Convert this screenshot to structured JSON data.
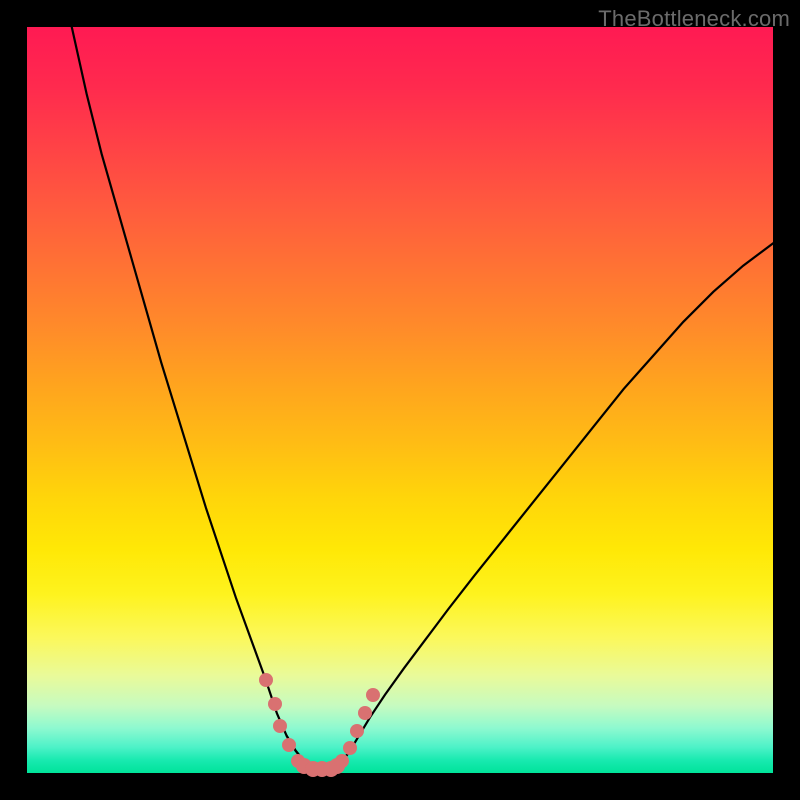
{
  "watermark": "TheBottleneck.com",
  "colors": {
    "frame_bg_top": "#ff1a53",
    "frame_bg_bottom": "#00e39a",
    "curve_stroke": "#000000",
    "marker_fill": "#d97171",
    "page_bg": "#000000",
    "watermark_text": "#6b6b6b"
  },
  "chart_data": {
    "type": "line",
    "title": "",
    "xlabel": "",
    "ylabel": "",
    "xlim": [
      0,
      100
    ],
    "ylim": [
      0,
      100
    ],
    "series": [
      {
        "name": "left-curve",
        "x": [
          6,
          8,
          10,
          12,
          14,
          16,
          18,
          20,
          22,
          24,
          26,
          28,
          30,
          32,
          33.5,
          34.8,
          36,
          37.2,
          38.4
        ],
        "y": [
          100,
          91,
          83,
          76,
          69,
          62,
          55,
          48.5,
          42,
          35.5,
          29.5,
          23.5,
          18,
          12.5,
          8,
          5,
          3,
          1.5,
          0.7
        ]
      },
      {
        "name": "right-curve",
        "x": [
          41.4,
          42.3,
          43.3,
          44.5,
          46,
          48,
          50.5,
          53.5,
          56.5,
          60,
          64,
          68,
          72,
          76,
          80,
          84,
          88,
          92,
          96,
          100
        ],
        "y": [
          0.7,
          1.6,
          3,
          5,
          7.5,
          10.5,
          14,
          18,
          22,
          26.5,
          31.5,
          36.5,
          41.5,
          46.5,
          51.5,
          56,
          60.5,
          64.5,
          68,
          71
        ]
      },
      {
        "name": "floor-segment",
        "x": [
          34.8,
          36,
          37.2,
          38.4,
          39.6,
          40.8,
          41.4,
          42.3,
          43.3
        ],
        "y": [
          5,
          3,
          1.5,
          0.7,
          0.5,
          0.7,
          0.7,
          1.6,
          3
        ]
      }
    ],
    "markers": {
      "left_cluster": [
        {
          "x": 32.0,
          "y": 12.5
        },
        {
          "x": 33.2,
          "y": 9.2
        },
        {
          "x": 33.9,
          "y": 6.3
        },
        {
          "x": 35.1,
          "y": 3.8
        },
        {
          "x": 36.3,
          "y": 1.6
        }
      ],
      "right_cluster": [
        {
          "x": 42.2,
          "y": 1.6
        },
        {
          "x": 43.3,
          "y": 3.4
        },
        {
          "x": 44.2,
          "y": 5.6
        },
        {
          "x": 45.3,
          "y": 8.0
        },
        {
          "x": 46.4,
          "y": 10.5
        }
      ],
      "floor_caps": [
        {
          "x": 37.1,
          "y": 0.9
        },
        {
          "x": 38.3,
          "y": 0.6
        },
        {
          "x": 39.5,
          "y": 0.5
        },
        {
          "x": 40.7,
          "y": 0.6
        },
        {
          "x": 41.5,
          "y": 0.9
        }
      ]
    }
  }
}
